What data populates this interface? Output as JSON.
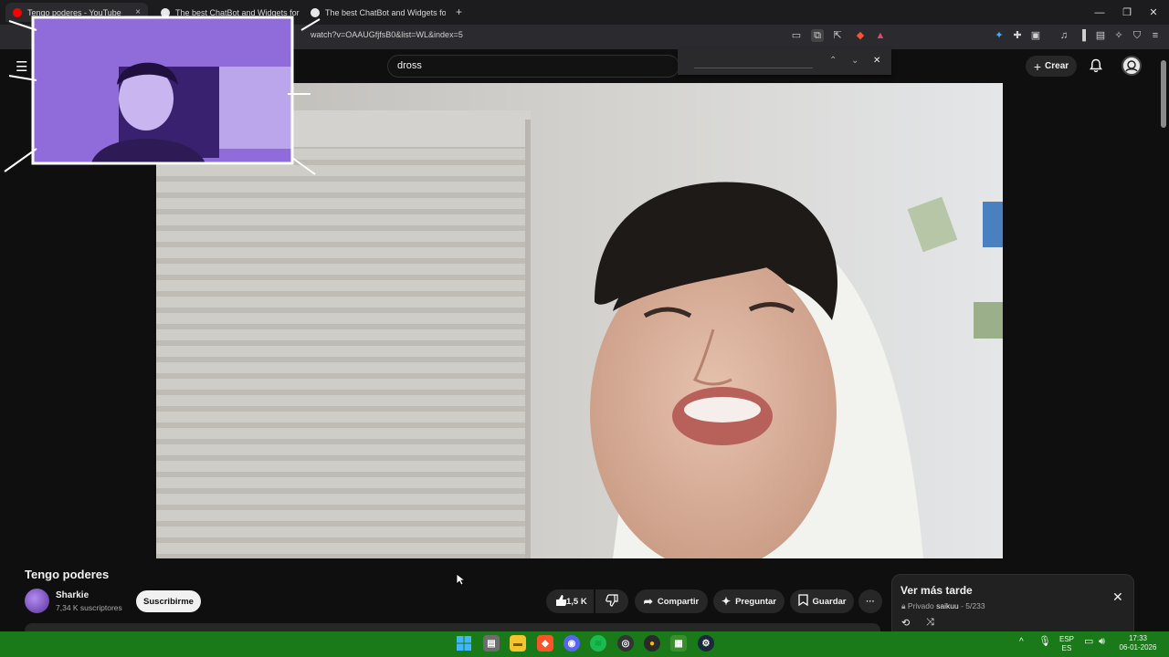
{
  "browser": {
    "tabs": [
      {
        "label": "Tengo poderes - YouTube",
        "active": true,
        "close": "×"
      },
      {
        "label": "The best ChatBot and Widgets for K",
        "active": false
      },
      {
        "label": "The best ChatBot and Widgets for Ki",
        "active": false
      }
    ],
    "new_tab": "+",
    "url": "watch?v=OAAUGfjfsB0&list=WL&index=5",
    "window_controls": {
      "minimize": "—",
      "maximize": "❐",
      "close": "✕"
    }
  },
  "youtube": {
    "search_value": "dross",
    "find_controls": {
      "up": "⌃",
      "down": "⌄",
      "close": "✕"
    },
    "create_label": "Crear",
    "create_icon": "+"
  },
  "video": {
    "title": "Tengo poderes",
    "channel": "Sharkie",
    "subscribers": "7,34 K suscriptores",
    "subscribe_label": "Suscribirme",
    "likes": "1,5 K",
    "share_label": "Compartir",
    "ask_label": "Preguntar",
    "save_label": "Guardar",
    "more": "···"
  },
  "playlist": {
    "title": "Ver más tarde",
    "privacy": "Privado",
    "owner": "saikuu",
    "position": "5/233"
  },
  "taskbar": {
    "lang_top": "ESP",
    "lang_bottom": "ES",
    "time": "17:33",
    "date": "06-01-2026",
    "chevron": "^"
  },
  "colors": {
    "taskbar": "#1a7a1a",
    "youtube_bg": "#0f0f0f",
    "cam_tint": "#7a4fd0"
  }
}
